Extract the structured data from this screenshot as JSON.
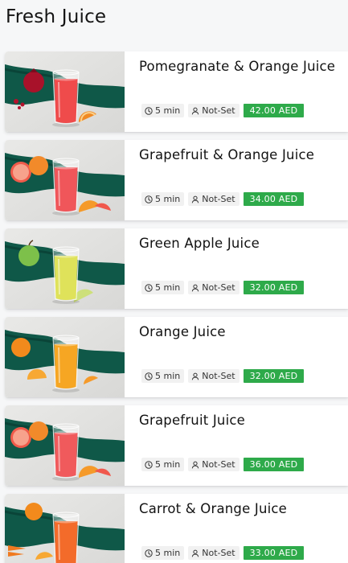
{
  "section": {
    "title": "Fresh Juice"
  },
  "products": [
    {
      "name": "Pomegranate & Orange Juice",
      "time": "5 min",
      "serving": "Not-Set",
      "price": "42.00 AED",
      "juice_color": "#ef4b4b",
      "fruit": "pomegranate"
    },
    {
      "name": "Grapefruit & Orange Juice",
      "time": "5 min",
      "serving": "Not-Set",
      "price": "34.00 AED",
      "juice_color": "#f0565a",
      "fruit": "grapefruit"
    },
    {
      "name": "Green Apple Juice",
      "time": "5 min",
      "serving": "Not-Set",
      "price": "32.00 AED",
      "juice_color": "#dfe25a",
      "fruit": "green-apple"
    },
    {
      "name": "Orange Juice",
      "time": "5 min",
      "serving": "Not-Set",
      "price": "32.00 AED",
      "juice_color": "#f6a623",
      "fruit": "orange"
    },
    {
      "name": "Grapefruit Juice",
      "time": "5 min",
      "serving": "Not-Set",
      "price": "36.00 AED",
      "juice_color": "#f05a5c",
      "fruit": "grapefruit"
    },
    {
      "name": "Carrot & Orange Juice",
      "time": "5 min",
      "serving": "Not-Set",
      "price": "33.00 AED",
      "juice_color": "#f36b2a",
      "fruit": "carrot"
    }
  ],
  "colors": {
    "price_badge": "#2eaa4a",
    "chip_bg": "#f1f1f1",
    "cloth": "#0f5848"
  }
}
